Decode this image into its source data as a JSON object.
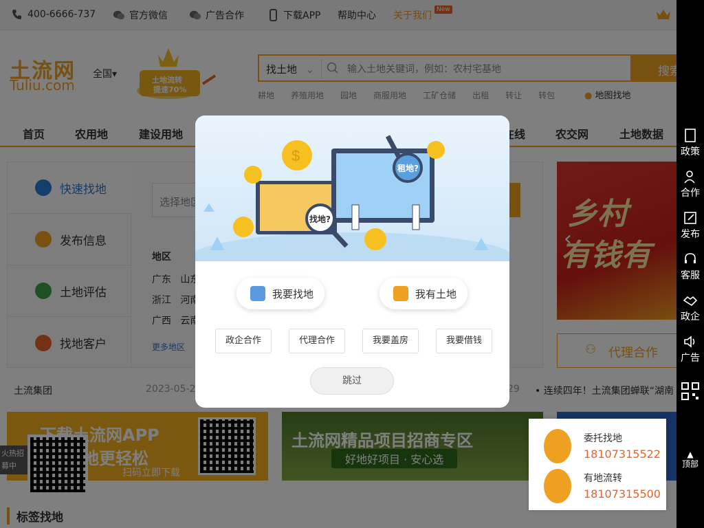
{
  "topbar": {
    "phone": "400-6666-737",
    "wechat": "官方微信",
    "ad_coop": "广告合作",
    "app": "下载APP",
    "help": "帮助中心",
    "about": "关于我们",
    "new_badge": "New"
  },
  "header": {
    "logo": "土流网",
    "logo_sub": "Tuliu.com",
    "city": "全国",
    "promo_line1": "土地流转",
    "promo_line2": "提速70%",
    "search_type": "找土地",
    "search_placeholder": "输入土地关键词，例如：农村宅基地",
    "search_button": "搜索",
    "tags": [
      "耕地",
      "养殖用地",
      "园地",
      "商服用地",
      "工矿仓储",
      "出租",
      "转让",
      "转包"
    ],
    "map_search": "地图找地"
  },
  "nav": [
    "首页",
    "农用地",
    "建设用地",
    "在线",
    "农交网",
    "土地数据"
  ],
  "quick": {
    "menu": [
      {
        "label": "快速找地",
        "color": "#2a7ad5"
      },
      {
        "label": "发布信息",
        "color": "#f0a020"
      },
      {
        "label": "土地评估",
        "color": "#3aa04a"
      },
      {
        "label": "找地客户",
        "color": "#e8632a"
      }
    ],
    "select_placeholder": "选择地区",
    "region_label": "地区",
    "rows": [
      [
        "广东",
        "山东"
      ],
      [
        "浙江",
        "河南"
      ],
      [
        "广西",
        "云南"
      ]
    ],
    "more": "更多地区"
  },
  "banner": {
    "text1": "乡村",
    "text2": "有钱有"
  },
  "agent_button": "代理合作",
  "news": {
    "left_title": "土流集团",
    "left_date": "2023-05-2",
    "right_date": "29",
    "right_title": "连续四年！土流集团蝉联“湖南"
  },
  "ads": {
    "app_line1": "下载土流网APP",
    "app_line2": "地更轻松",
    "app_line3": "扫码立即下载",
    "project_line1": "土流网精品项目招商专区",
    "project_line2": "好地好项目 · 安心选"
  },
  "section_title": "标签找地",
  "hot_text": "火热招募中",
  "consult": [
    {
      "title": "委托找地",
      "phone": "18107315522"
    },
    {
      "title": "有地流转",
      "phone": "18107315500"
    }
  ],
  "sidebar": [
    "政策",
    "合作",
    "发布",
    "客服",
    "政企",
    "广告",
    "顶部"
  ],
  "modal": {
    "bubble_find": "找地?",
    "bubble_rent": "租地?",
    "find_land": "我要找地",
    "have_land": "我有土地",
    "tags": [
      "政企合作",
      "代理合作",
      "我要盖房",
      "我要借钱"
    ],
    "skip": "跳过"
  },
  "colors": {
    "brand": "#f0a020",
    "accent_blue": "#2a7ad5",
    "phone_red": "#e8632a"
  }
}
